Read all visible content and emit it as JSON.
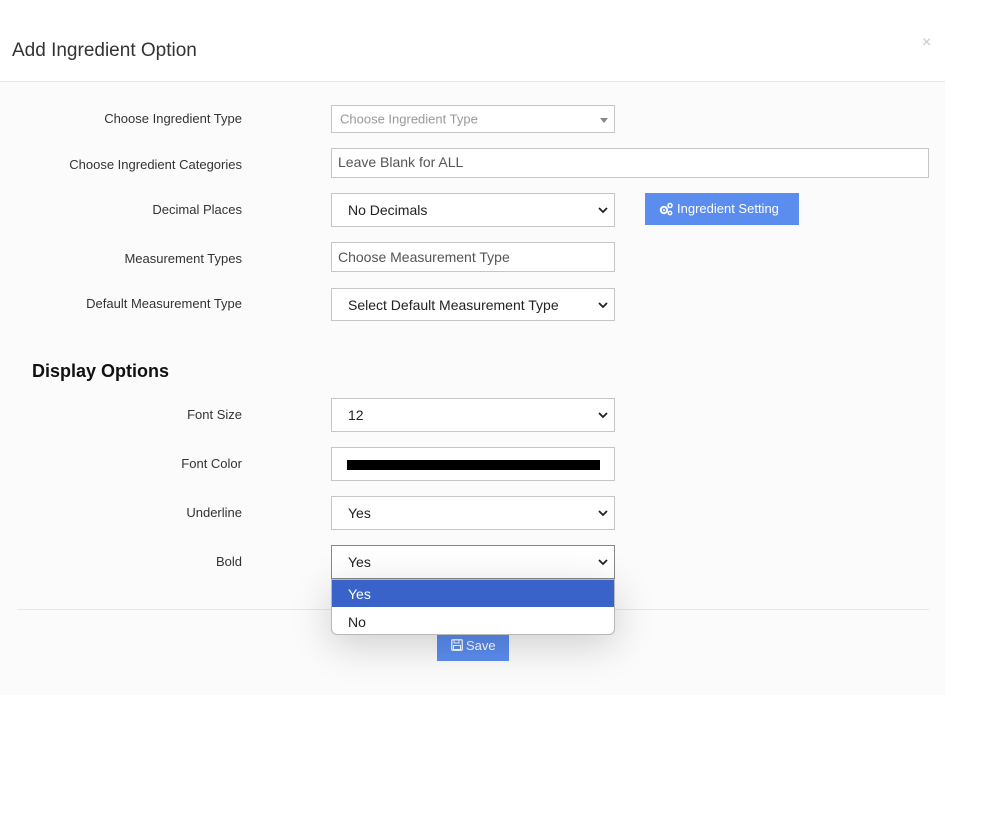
{
  "dialog": {
    "title": "Add Ingredient Option",
    "close_label": "×"
  },
  "form": {
    "ingredient_type": {
      "label": "Choose Ingredient Type",
      "placeholder": "Choose Ingredient Type"
    },
    "ingredient_categories": {
      "label": "Choose Ingredient Categories",
      "value": "Leave Blank for ALL"
    },
    "decimal_places": {
      "label": "Decimal Places",
      "selected": "No Decimals"
    },
    "ingredient_setting_button": {
      "label": "Ingredient Setting",
      "icon": "gears-icon"
    },
    "measurement_types": {
      "label": "Measurement Types",
      "placeholder": "Choose Measurement Type"
    },
    "default_measurement_type": {
      "label": "Default Measurement Type",
      "selected": "Select Default Measurement Type"
    }
  },
  "display_options": {
    "title": "Display Options",
    "font_size": {
      "label": "Font Size",
      "selected": "12"
    },
    "font_color": {
      "label": "Font Color",
      "value": "#000000"
    },
    "underline": {
      "label": "Underline",
      "selected": "Yes"
    },
    "bold": {
      "label": "Bold",
      "selected": "Yes",
      "options": [
        "Yes",
        "No"
      ],
      "highlighted_option": "Yes"
    }
  },
  "footer": {
    "save_label": "Save",
    "save_icon": "floppy-disk-icon"
  },
  "colors": {
    "primary_button": "#5b8def",
    "dropdown_highlight": "#3a63c9"
  }
}
